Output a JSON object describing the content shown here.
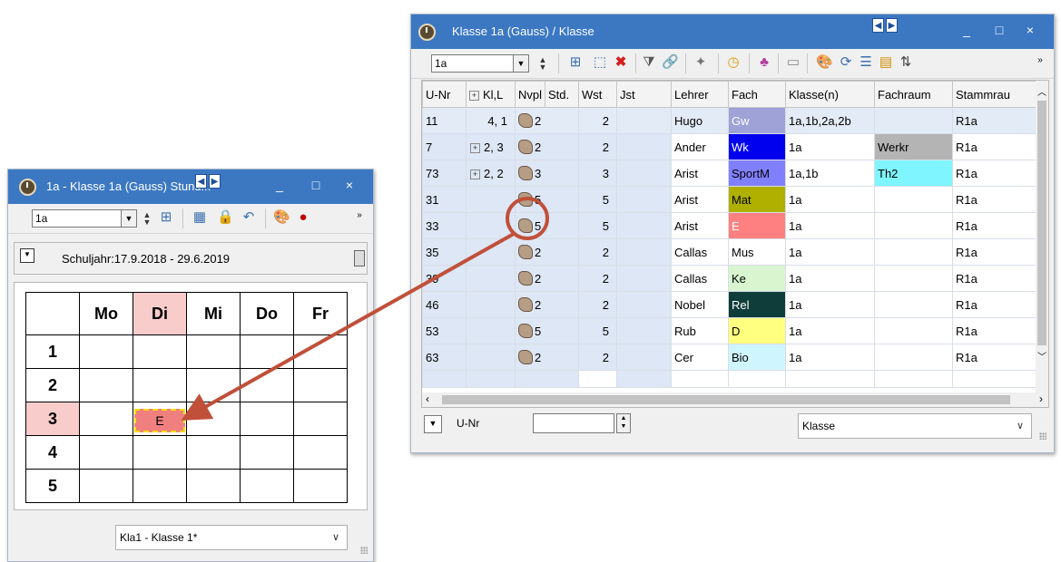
{
  "small_window": {
    "title": "1a - Klasse 1a (Gauss) Stund...",
    "title_buttons": [
      "_",
      "□",
      "×"
    ],
    "class_combo": "1a",
    "school_year": "Schuljahr:17.9.2018 - 29.6.2019",
    "days": [
      "Mo",
      "Di",
      "Mi",
      "Do",
      "Fr"
    ],
    "periods": [
      "1",
      "2",
      "3",
      "4",
      "5"
    ],
    "highlighted_day": "Di",
    "highlighted_period": "3",
    "lesson": {
      "label": "E",
      "day": "Di",
      "period": "3",
      "color": "#f08080"
    },
    "bottom_select": "Kla1 - Klasse 1*"
  },
  "large_window": {
    "title": "Klasse 1a (Gauss) / Klasse",
    "title_buttons": [
      "_",
      "□",
      "×"
    ],
    "class_combo": "1a",
    "columns": [
      "U-Nr",
      "Kl,L",
      "Nvpl",
      "Std.",
      "Wst",
      "Jst",
      "Lehrer",
      "Fach",
      "Klasse(n)",
      "Fachraum",
      "Stammrau"
    ],
    "rows": [
      {
        "unr": "11",
        "kl": "4, 1",
        "exp": false,
        "std": "2",
        "wst": "2",
        "jst": "",
        "lehrer": "Hugo",
        "fach": "Gw",
        "fach_bg": "#9ea2d6",
        "fach_fg": "#ffffff",
        "klassen": "1a,1b,2a,2b",
        "fachraum": "",
        "fr_bg": "",
        "stamm": "R1a"
      },
      {
        "unr": "7",
        "kl": "2, 3",
        "exp": true,
        "std": "2",
        "wst": "2",
        "jst": "",
        "lehrer": "Ander",
        "fach": "Wk",
        "fach_bg": "#0000ee",
        "fach_fg": "#ffffff",
        "klassen": "1a",
        "fachraum": "Werkr",
        "fr_bg": "#b4b4b4",
        "stamm": "R1a"
      },
      {
        "unr": "73",
        "kl": "2, 2",
        "exp": true,
        "std": "3",
        "wst": "3",
        "jst": "",
        "lehrer": "Arist",
        "fach": "SportM",
        "fach_bg": "#8080ff",
        "fach_fg": "#000000",
        "klassen": "1a,1b",
        "fachraum": "Th2",
        "fr_bg": "#7ff5ff",
        "stamm": "R1a"
      },
      {
        "unr": "31",
        "kl": "",
        "exp": false,
        "std": "5",
        "wst": "5",
        "jst": "",
        "lehrer": "Arist",
        "fach": "Mat",
        "fach_bg": "#b0b000",
        "fach_fg": "#000000",
        "klassen": "1a",
        "fachraum": "",
        "fr_bg": "",
        "stamm": "R1a"
      },
      {
        "unr": "33",
        "kl": "",
        "exp": false,
        "std": "5",
        "wst": "5",
        "jst": "",
        "lehrer": "Arist",
        "fach": "E",
        "fach_bg": "#ff8080",
        "fach_fg": "#ffffff",
        "klassen": "1a",
        "fachraum": "",
        "fr_bg": "",
        "stamm": "R1a"
      },
      {
        "unr": "35",
        "kl": "",
        "exp": false,
        "std": "2",
        "wst": "2",
        "jst": "",
        "lehrer": "Callas",
        "fach": "Mus",
        "fach_bg": "#ffffff",
        "fach_fg": "#000000",
        "klassen": "1a",
        "fachraum": "",
        "fr_bg": "",
        "stamm": "R1a"
      },
      {
        "unr": "39",
        "kl": "",
        "exp": false,
        "std": "2",
        "wst": "2",
        "jst": "",
        "lehrer": "Callas",
        "fach": "Ke",
        "fach_bg": "#d8f5d0",
        "fach_fg": "#000000",
        "klassen": "1a",
        "fachraum": "",
        "fr_bg": "",
        "stamm": "R1a"
      },
      {
        "unr": "46",
        "kl": "",
        "exp": false,
        "std": "2",
        "wst": "2",
        "jst": "",
        "lehrer": "Nobel",
        "fach": "Rel",
        "fach_bg": "#0f3d3a",
        "fach_fg": "#ffffff",
        "klassen": "1a",
        "fachraum": "",
        "fr_bg": "",
        "stamm": "R1a"
      },
      {
        "unr": "53",
        "kl": "",
        "exp": false,
        "std": "5",
        "wst": "5",
        "jst": "",
        "lehrer": "Rub",
        "fach": "D",
        "fach_bg": "#ffff80",
        "fach_fg": "#000000",
        "klassen": "1a",
        "fachraum": "",
        "fr_bg": "",
        "stamm": "R1a"
      },
      {
        "unr": "63",
        "kl": "",
        "exp": false,
        "std": "2",
        "wst": "2",
        "jst": "",
        "lehrer": "Cer",
        "fach": "Bio",
        "fach_bg": "#cff5ff",
        "fach_fg": "#000000",
        "klassen": "1a",
        "fachraum": "",
        "fr_bg": "",
        "stamm": "R1a"
      }
    ],
    "footer_label": "U-Nr",
    "footer_select": "Klasse"
  },
  "annotation": {
    "arrow_color": "#c0503a"
  }
}
